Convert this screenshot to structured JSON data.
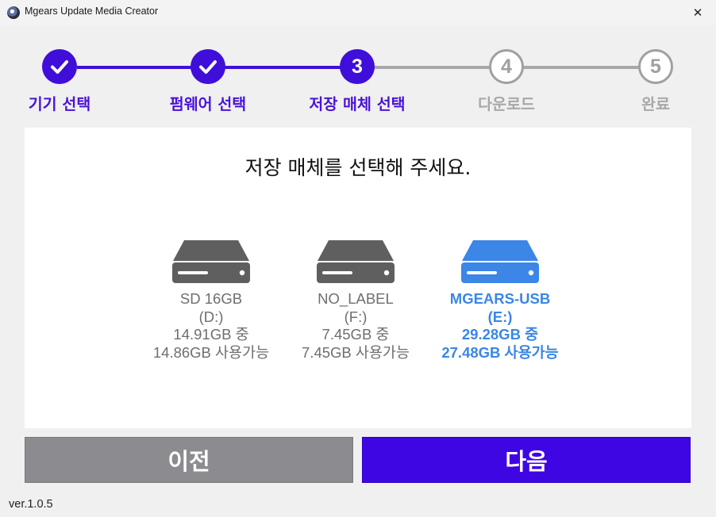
{
  "window": {
    "title": "Mgears Update Media Creator",
    "close_glyph": "✕"
  },
  "steps": [
    {
      "label": "기기 선택",
      "state": "done"
    },
    {
      "label": "펌웨어 선택",
      "state": "done"
    },
    {
      "number": "3",
      "label": "저장 매체 선택",
      "state": "active"
    },
    {
      "number": "4",
      "label": "다운로드",
      "state": "pending"
    },
    {
      "number": "5",
      "label": "완료",
      "state": "pending"
    }
  ],
  "prompt": "저장 매체를 선택해 주세요.",
  "drives": [
    {
      "name": "SD 16GB",
      "letter": "(D:)",
      "total": "14.91GB 중",
      "free": "14.86GB 사용가능",
      "selected": false,
      "icon": "hard-drive-icon"
    },
    {
      "name": "NO_LABEL",
      "letter": "(F:)",
      "total": "7.45GB 중",
      "free": "7.45GB 사용가능",
      "selected": false,
      "icon": "hard-drive-icon"
    },
    {
      "name": "MGEARS-USB",
      "letter": "(E:)",
      "total": "29.28GB 중",
      "free": "27.48GB 사용가능",
      "selected": true,
      "icon": "hard-drive-icon"
    }
  ],
  "buttons": {
    "prev": "이전",
    "next": "다음"
  },
  "version": "ver.1.0.5",
  "colors": {
    "accent": "#3f06e4",
    "step_done": "#3f0fd9",
    "step_pending": "#a0a0a0",
    "drive_selected": "#3b86e6",
    "drive_normal": "#5f5f5f",
    "prev_button": "#8c8c90"
  }
}
